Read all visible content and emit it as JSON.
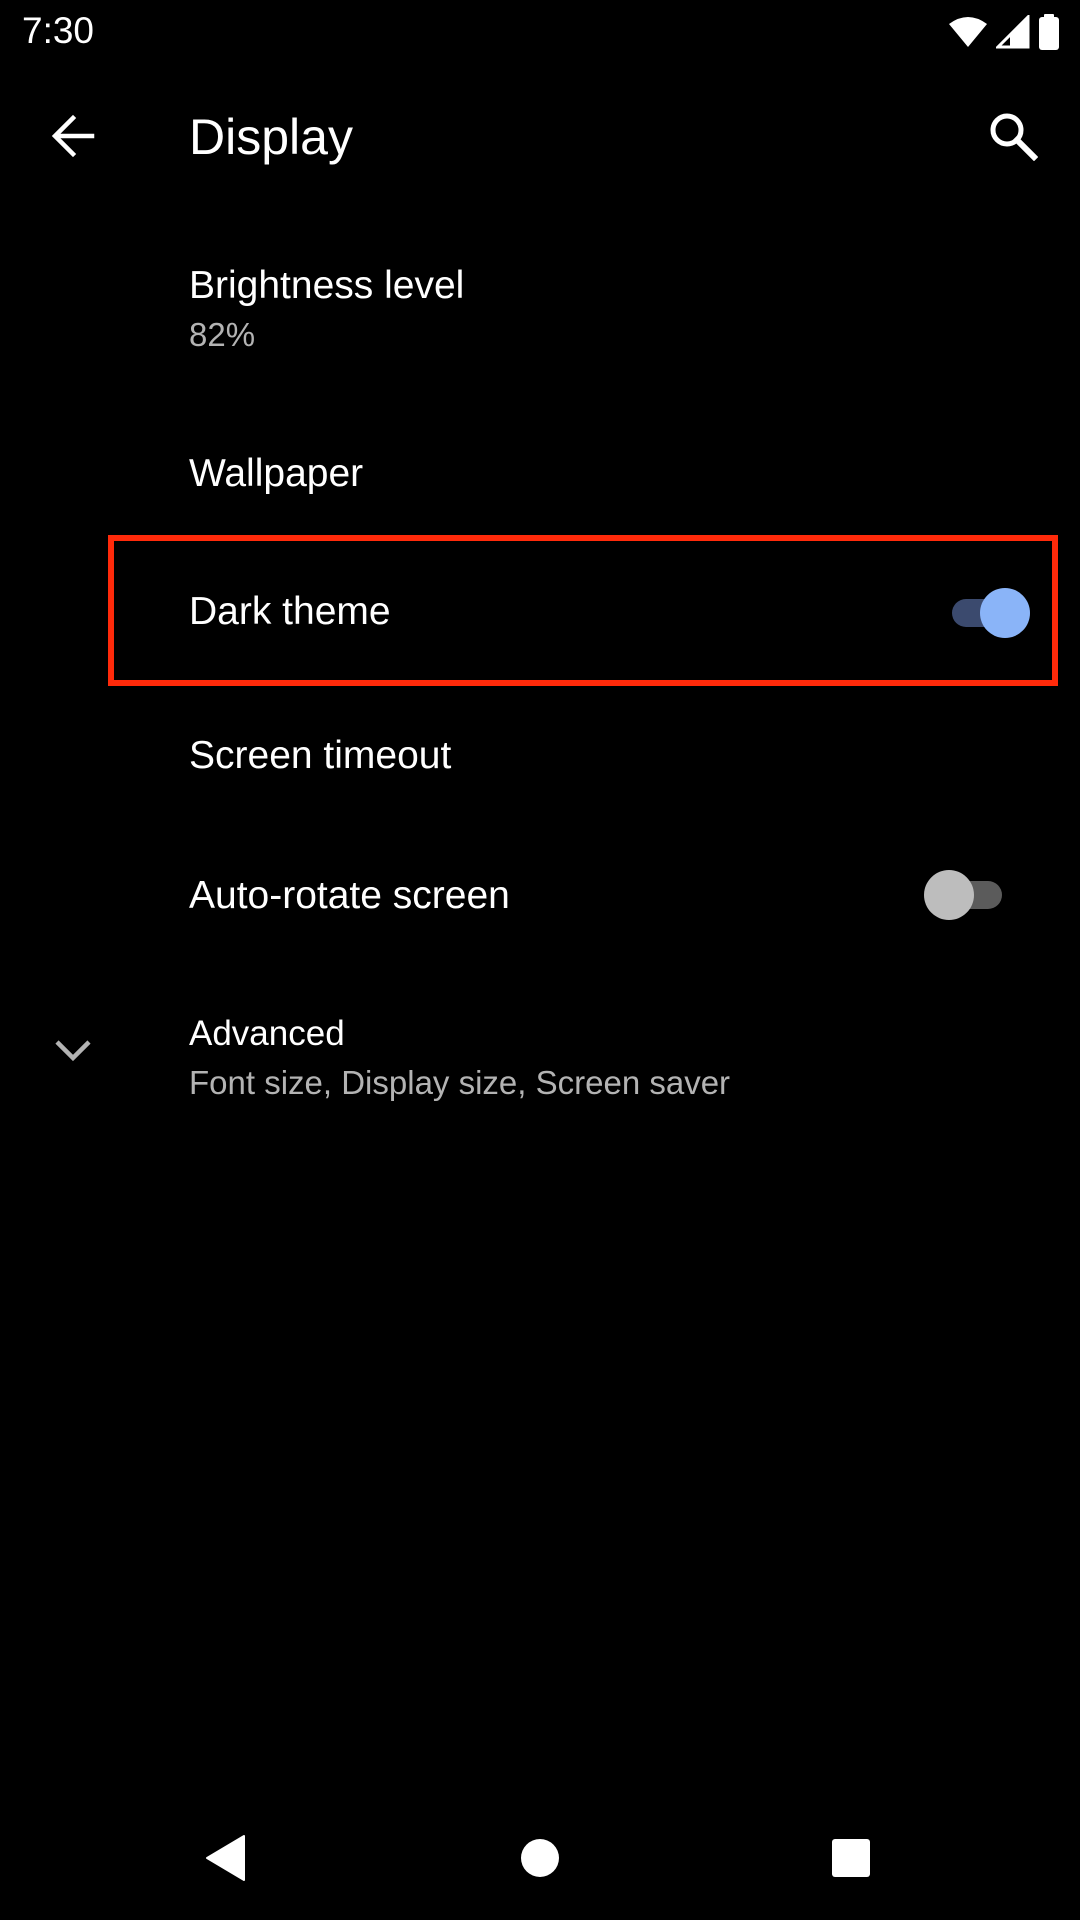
{
  "status_bar": {
    "time": "7:30",
    "icons": [
      "wifi-icon",
      "cell-signal-icon",
      "battery-icon"
    ]
  },
  "toolbar": {
    "title": "Display",
    "back_icon": "arrow-back-icon",
    "search_icon": "search-icon"
  },
  "settings": {
    "brightness": {
      "title": "Brightness level",
      "summary": "82%"
    },
    "wallpaper": {
      "title": "Wallpaper"
    },
    "dark_theme": {
      "title": "Dark theme",
      "enabled": true
    },
    "screen_timeout": {
      "title": "Screen timeout"
    },
    "auto_rotate": {
      "title": "Auto-rotate screen",
      "enabled": false
    },
    "advanced": {
      "title": "Advanced",
      "summary": "Font size, Display size, Screen saver",
      "icon": "chevron-down-icon"
    }
  },
  "highlight": {
    "target": "dark_theme",
    "color": "#ff2a0a"
  },
  "colors": {
    "background": "#000000",
    "switch_on_thumb": "#8ab4f8",
    "switch_on_track": "#3b4a6e",
    "switch_off_thumb": "#bdbdbd",
    "switch_off_track": "#5b5b5b"
  },
  "nav_bar": {
    "icons": [
      "nav-back-icon",
      "nav-home-icon",
      "nav-recents-icon"
    ]
  }
}
